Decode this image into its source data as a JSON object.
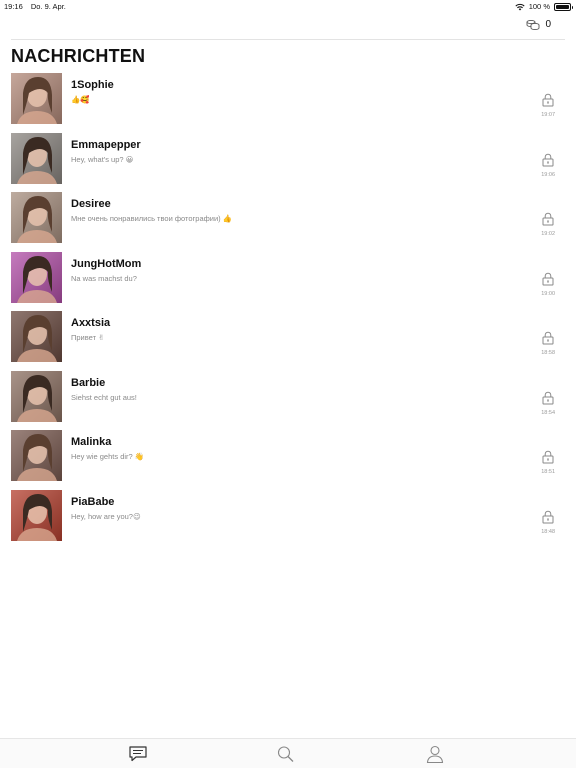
{
  "status": {
    "time": "19:16",
    "date": "Do. 9. Apr.",
    "battery": "100 %"
  },
  "header": {
    "coin_count": "0",
    "title": "NACHRICHTEN"
  },
  "chats": [
    {
      "name": "1Sophie",
      "preview": "👍🥰",
      "time": "19:07",
      "avatar_color": "#b38a7a"
    },
    {
      "name": "Emmapepper",
      "preview": "Hey, what's up? 😀",
      "time": "19:06",
      "avatar_color": "#8a8580"
    },
    {
      "name": "Desiree",
      "preview": "Мне очень понравились твои фотографии) 👍",
      "time": "19:02",
      "avatar_color": "#a89080"
    },
    {
      "name": "JungHotMom",
      "preview": "Na was machst du?",
      "time": "19:00",
      "avatar_color": "#b24fa8"
    },
    {
      "name": "Axxtsia",
      "preview": "Привет ✌",
      "time": "18:58",
      "avatar_color": "#6a4a40"
    },
    {
      "name": "Barbie",
      "preview": "Siehst echt gut aus!",
      "time": "18:54",
      "avatar_color": "#8c7062"
    },
    {
      "name": "Malinka",
      "preview": "Hey wie gehts dir? 👋",
      "time": "18:51",
      "avatar_color": "#7a5a50"
    },
    {
      "name": "PiaBabe",
      "preview": "Hey, how are you?😉",
      "time": "18:48",
      "avatar_color": "#b5402f"
    }
  ],
  "tabs": {
    "icons": [
      "chat-bubble-icon",
      "search-icon",
      "profile-icon"
    ]
  }
}
